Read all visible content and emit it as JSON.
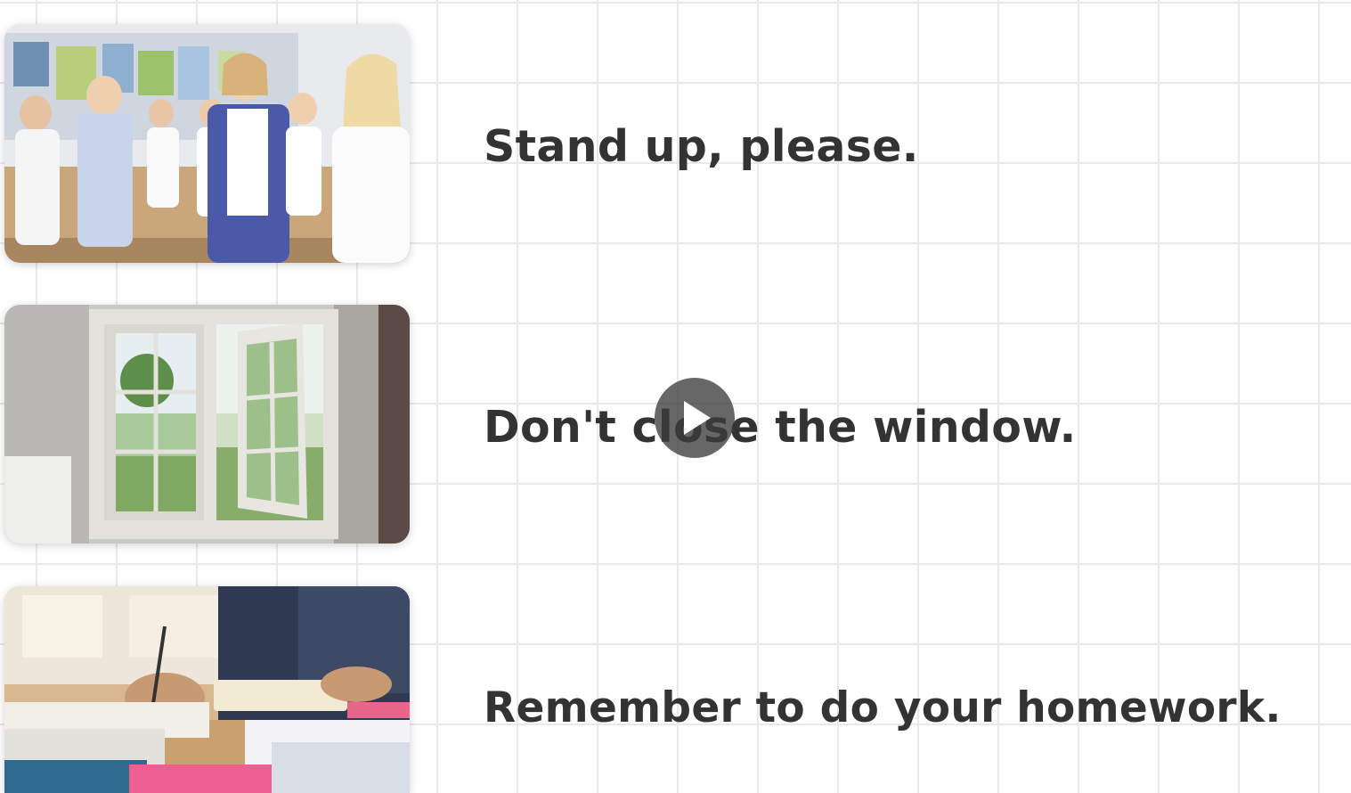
{
  "phrases": [
    {
      "text": "Stand up, please.",
      "image": "students-standing-in-classroom-photo"
    },
    {
      "text": "Don't close the window.",
      "image": "open-window-photo"
    },
    {
      "text": "Remember to do your homework.",
      "image": "student-writing-homework-photo"
    }
  ],
  "player": {
    "icon": "play-icon"
  },
  "colors": {
    "text": "#333333",
    "grid": "#e9e9e9",
    "background": "#ffffff",
    "play_overlay": "#3c3c3c"
  }
}
